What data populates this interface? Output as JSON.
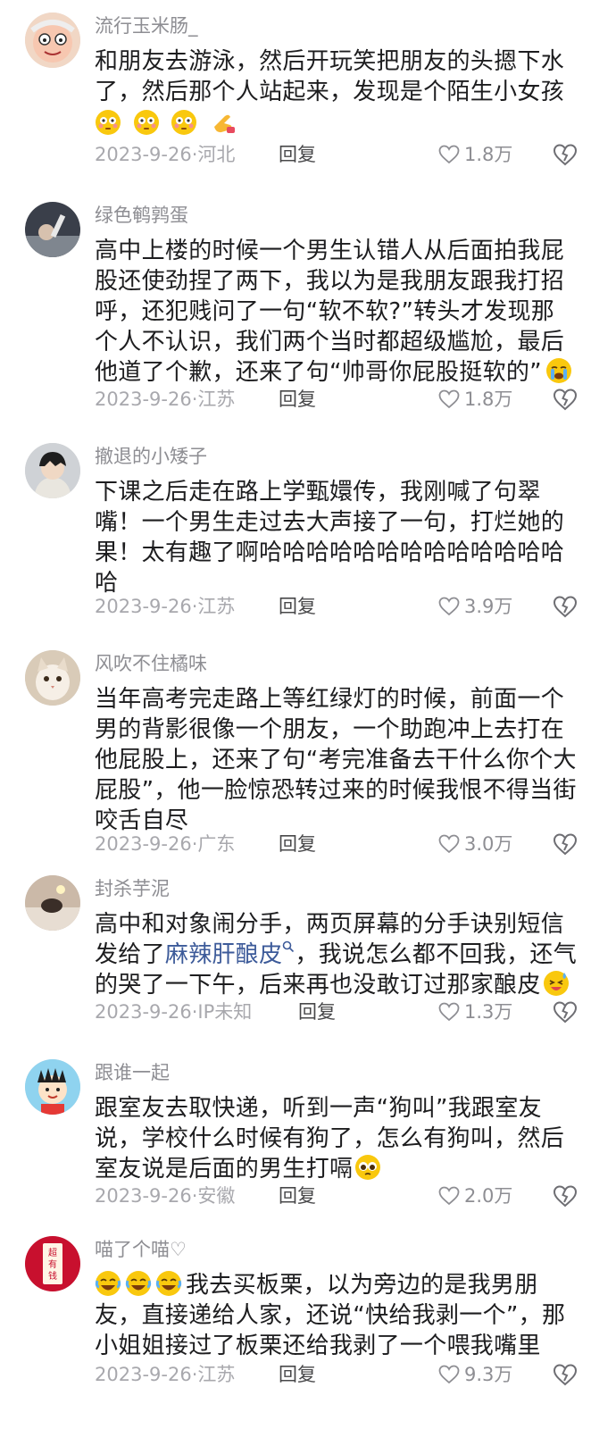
{
  "comments": [
    {
      "username": "流行玉米肠_",
      "lines": [
        "和朋友去游泳，然后开玩笑把朋友的头摁下水",
        "了，然后那个人站起来，发现是个陌生小女孩"
      ],
      "emoji_line": [
        "flushed-emoji",
        "flushed-emoji",
        "flushed-emoji",
        "pointing-hand-emoji"
      ],
      "date": "2023-9-26",
      "location": "河北",
      "reply": "回复",
      "likes": "1.8万"
    },
    {
      "username": "绿色鹌鹑蛋",
      "lines": [
        "高中上楼的时候一个男生认错人从后面拍我屁",
        "股还使劲捏了两下，我以为是我朋友跟我打招",
        "呼，还犯贱问了一句“软不软?”转头才发现那",
        "个人不认识，我们两个当时都超级尴尬，最后",
        "他道了个歉，还来了句“帅哥你屁股挺软的”"
      ],
      "trailing_emoji": "crying-emoji",
      "date": "2023-9-26",
      "location": "江苏",
      "reply": "回复",
      "likes": "1.8万"
    },
    {
      "username": "撤退的小矮子",
      "lines": [
        "下课之后走在路上学甄嬛传，我刚喊了句翠",
        "嘴！一个男生走过去大声接了一句，打烂她的",
        "果！太有趣了啊哈哈哈哈哈哈哈哈哈哈哈哈哈",
        "哈"
      ],
      "date": "2023-9-26",
      "location": "江苏",
      "reply": "回复",
      "likes": "3.9万"
    },
    {
      "username": "风吹不住橘味",
      "lines": [
        "当年高考完走路上等红绿灯的时候，前面一个",
        "男的背影很像一个朋友，一个助跑冲上去打在",
        "他屁股上，还来了句“考完准备去干什么你个大",
        "屁股”，他一脸惊恐转过来的时候我恨不得当街",
        "咬舌自尽"
      ],
      "date": "2023-9-26",
      "location": "广东",
      "reply": "回复",
      "likes": "3.0万"
    },
    {
      "username": "封杀芋泥",
      "line1": "高中和对象闹分手，两页屏幕的分手诀别短信",
      "line2_before": "发给了",
      "line2_link": "麻辣肝酿皮",
      "line2_after": "，我说怎么都不回我，还气",
      "line3": "的哭了一下午，后来再也没敢订过那家酿皮",
      "trailing_emoji": "sweat-smile-emoji",
      "date": "2023-9-26",
      "location": "IP未知",
      "reply": "回复",
      "likes": "1.3万"
    },
    {
      "username": "跟谁一起",
      "lines": [
        "跟室友去取快递，听到一声“狗叫”我跟室友",
        "说，学校什么时候有狗了，怎么有狗叫，然后",
        "室友说是后面的男生打嗝"
      ],
      "trailing_emoji": "pleading-emoji",
      "date": "2023-9-26",
      "location": "安徽",
      "reply": "回复",
      "likes": "2.0万"
    },
    {
      "username": "喵了个喵♡",
      "line1_emojis": [
        "laughing-tears-emoji",
        "laughing-tears-emoji",
        "laughing-tears-emoji"
      ],
      "line1": "我去买板栗，以为旁边的是我男朋",
      "lines": [
        "友，直接递给人家，还说“快给我剥一个”，那",
        "小姐姐接过了板栗还给我剥了一个喂我嘴里"
      ],
      "date": "2023-9-26",
      "location": "江苏",
      "reply": "回复",
      "likes": "9.3万"
    }
  ],
  "avatar_badge_text": "超有钱"
}
